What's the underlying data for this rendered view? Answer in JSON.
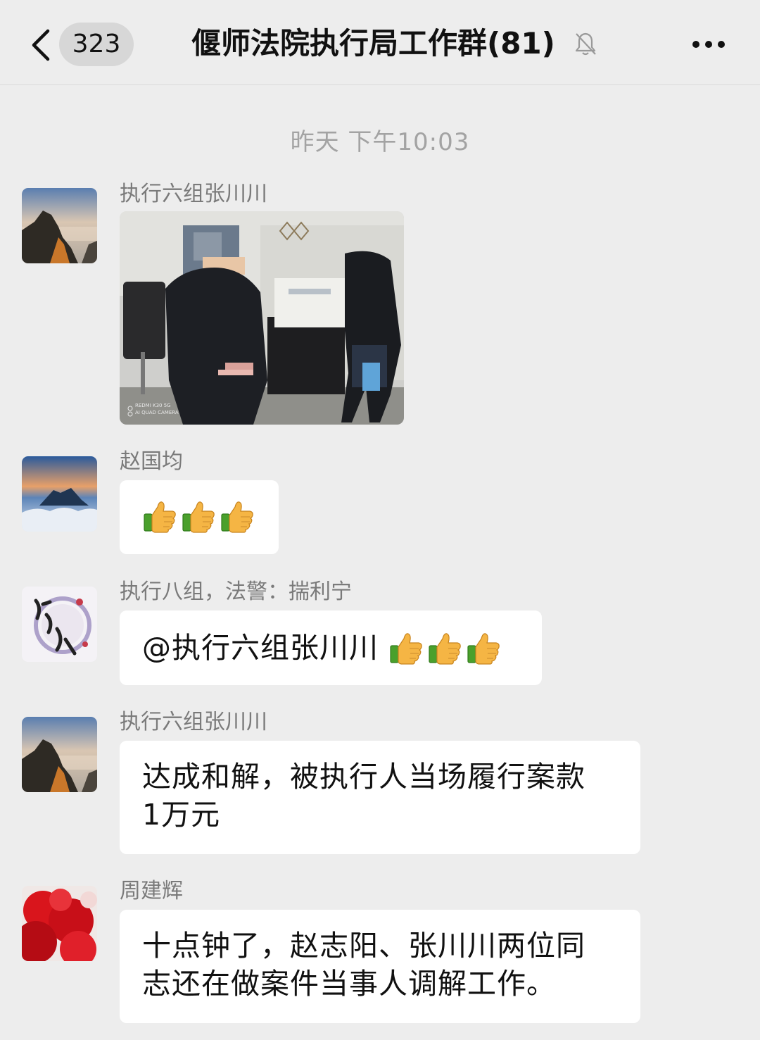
{
  "header": {
    "unread_count": "323",
    "title": "偃师法院执行局工作群(81)",
    "back_icon": "chevron-left-icon",
    "mute_icon": "bell-off-icon",
    "more_icon": "more-dots-icon"
  },
  "timestamp": "昨天 下午10:03",
  "messages": [
    {
      "sender": "执行六组张川川",
      "type": "image",
      "image_watermark": [
        "REDMI K30 5G",
        "AI QUAD CAMERA"
      ]
    },
    {
      "sender": "赵国均",
      "type": "emoji",
      "emoji": "thumbs-up",
      "count": 3
    },
    {
      "sender": "执行八组，法警：揣利宁",
      "type": "text",
      "text": "@执行六组张川川 ",
      "emoji": "thumbs-up",
      "count": 3
    },
    {
      "sender": "执行六组张川川",
      "type": "text",
      "line1": "达成和解，被执行人当场履行案款",
      "line2": "1万元"
    },
    {
      "sender": "周建辉",
      "type": "text",
      "line1": "十点钟了，赵志阳、张川川两位同",
      "line2": "志还在做案件当事人调解工作。"
    }
  ],
  "colors": {
    "background": "#ededed",
    "bubble": "#ffffff",
    "timestamp": "#a3a3a3",
    "sender": "#7a7a7a"
  }
}
